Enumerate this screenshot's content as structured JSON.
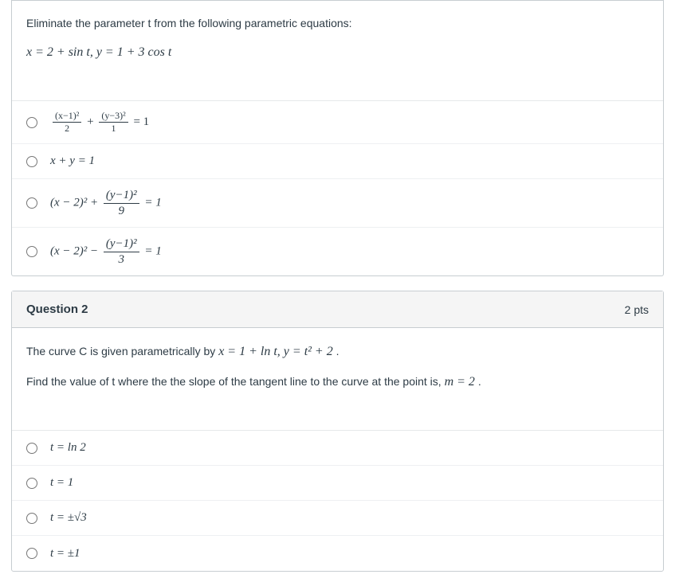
{
  "q1": {
    "prompt": "Eliminate the parameter t from the following parametric equations:",
    "equation": "x = 2 + sin t,  y = 1 + 3 cos t",
    "options": {
      "a_num1": "(x−1)²",
      "a_den1": "2",
      "a_plus": "+",
      "a_num2": "(y−3)²",
      "a_den2": "1",
      "a_tail": " = 1",
      "b": "x + y = 1",
      "c_lead": "(x − 2)² + ",
      "c_num": "(y−1)²",
      "c_den": "9",
      "c_tail": " = 1",
      "d_lead": "(x − 2)² − ",
      "d_num": "(y−1)²",
      "d_den": "3",
      "d_tail": " = 1"
    }
  },
  "q2": {
    "title": "Question 2",
    "pts": "2 pts",
    "prompt1a": "The curve C is given parametrically by ",
    "prompt1b": "x = 1 + ln t,  y = t² + 2",
    "prompt1c": " .",
    "prompt2a": "Find the value of t where the the slope of the tangent line to the curve at the point is,  ",
    "prompt2b": "m = 2",
    "prompt2c": ".",
    "options": {
      "a": "t = ln 2",
      "b": "t = 1",
      "c": "t = ±√3",
      "d": "t = ±1"
    }
  }
}
